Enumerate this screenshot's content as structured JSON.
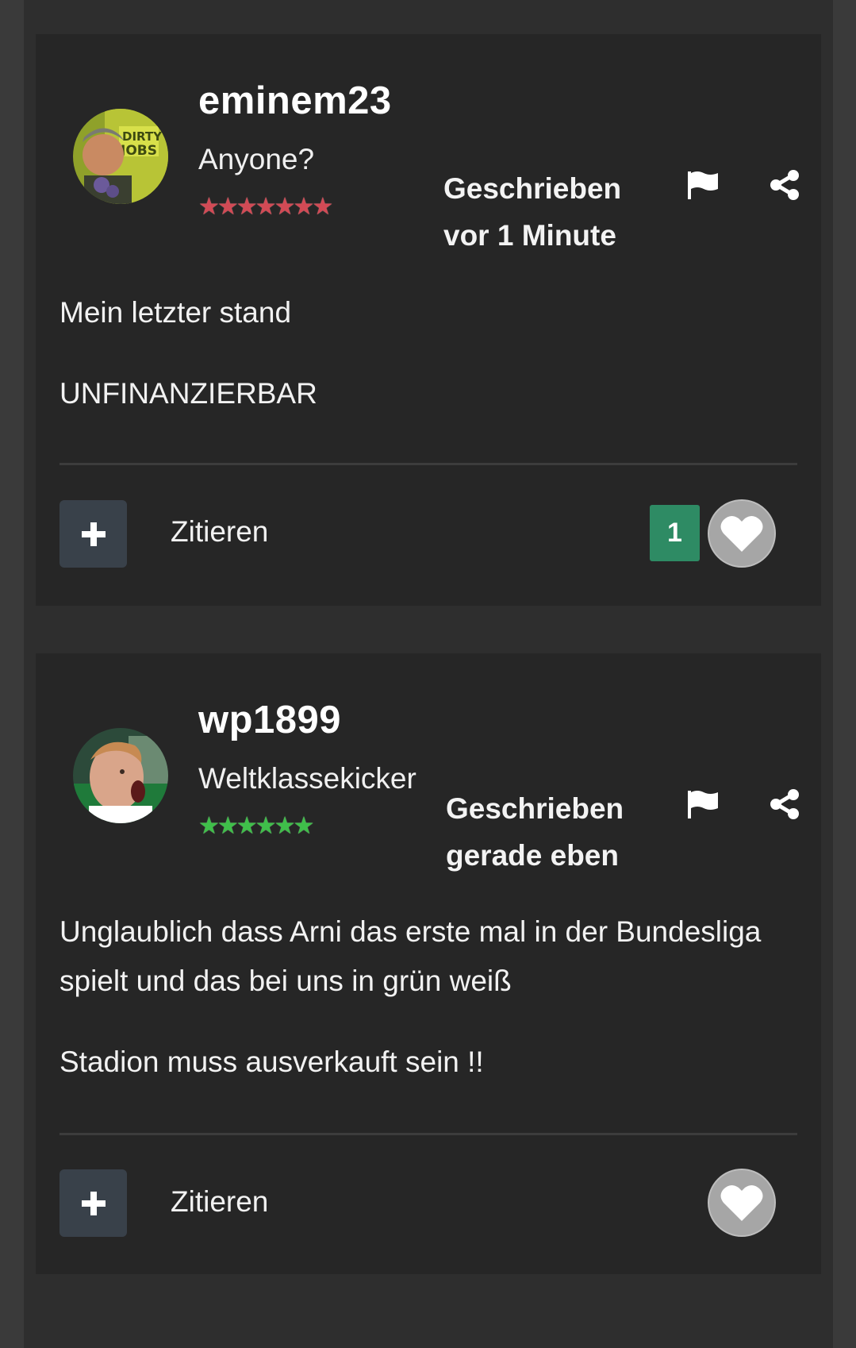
{
  "posts": [
    {
      "username": "eminem23",
      "user_title": "Anyone?",
      "stars": "★★★★★★★",
      "star_color": "#d24a55",
      "posted_line1": "Geschrieben",
      "posted_line2": "vor 1 Minute",
      "content": [
        "Mein letzter stand",
        "UNFINANZIERBAR"
      ],
      "quote_label": "Zitieren",
      "like_count": "1",
      "avatar_icon": "avatar-dirty-jobs"
    },
    {
      "username": "wp1899",
      "user_title": "Weltklassekicker",
      "stars": "★★★★★★",
      "star_color": "#3fbf4a",
      "posted_line1": "Geschrieben",
      "posted_line2": "gerade eben",
      "content": [
        "Unglaublich dass Arni das erste mal in der Bundesliga spielt und das bei uns in grün weiß",
        "Stadion muss ausverkauft sein !!"
      ],
      "quote_label": "Zitieren",
      "avatar_icon": "avatar-player"
    }
  ],
  "icons": {
    "flag": "flag-icon",
    "share": "share-icon",
    "plus": "plus-icon",
    "heart": "heart-icon"
  },
  "colors": {
    "like_badge": "#2e8b64",
    "like_button": "#a6a6a6",
    "quote_button": "#39414a"
  }
}
